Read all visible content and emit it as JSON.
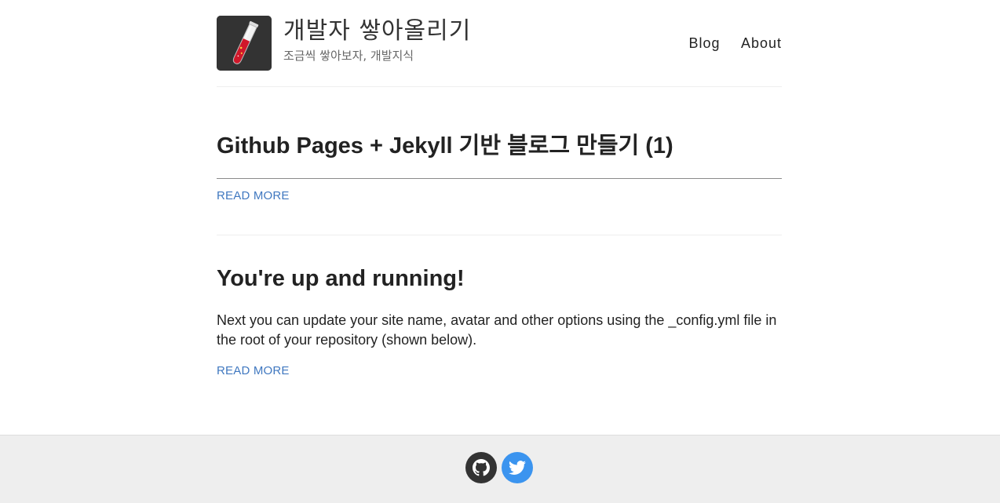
{
  "site": {
    "name": "개발자 쌓아올리기",
    "description": "조금씩 쌓아보자, 개발지식"
  },
  "nav": {
    "items": [
      "Blog",
      "About"
    ]
  },
  "posts": [
    {
      "title": "Github Pages + Jekyll 기반 블로그 만들기 (1)",
      "excerpt": "",
      "read_more": "READ MORE"
    },
    {
      "title": "You're up and running!",
      "excerpt": "Next you can update your site name, avatar and other options using the _config.yml file in the root of your repository (shown below).",
      "read_more": "READ MORE"
    }
  ],
  "footer": {
    "social": [
      {
        "icon": "github-icon",
        "color": "#333333"
      },
      {
        "icon": "twitter-icon",
        "color": "#3b94ef"
      }
    ]
  },
  "colors": {
    "link": "#4078c0",
    "footer_bg": "#eeeeee",
    "text": "#222222"
  }
}
